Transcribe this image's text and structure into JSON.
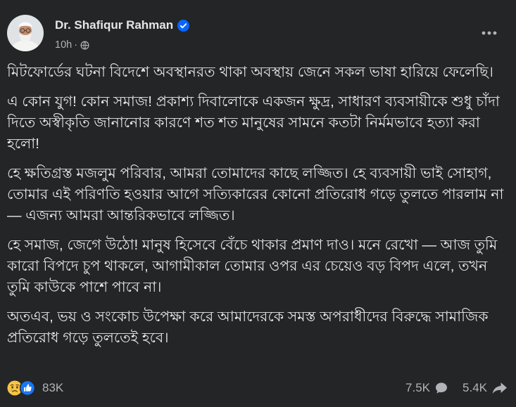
{
  "post": {
    "author": {
      "name": "Dr. Shafiqur Rahman",
      "verified": true,
      "avatar_icon": "profile-photo"
    },
    "timestamp": "10h",
    "separator": "·",
    "privacy_icon": "globe-icon",
    "more_icon": "more-options-icon",
    "paragraphs": [
      "মিটফোর্ডের ঘটনা বিদেশে অবস্থানরত থাকা অবস্থায় জেনে সকল ভাষা হারিয়ে ফেলেছি।",
      "এ কোন যুগ! কোন সমাজ! প্রকাশ্য দিবালোকে একজন ক্ষুদ্র, সাধারণ ব্যবসায়ীকে শুধু চাঁদা দিতে অস্বীকৃতি জানানোর কারণে শত শত মানুষের সামনে কতটা নির্মমভাবে হত্যা করা হলো!",
      "হে ক্ষতিগ্রস্ত মজলুম পরিবার, আমরা তোমাদের কাছে লজ্জিত। হে ব্যবসায়ী ভাই সোহাগ, তোমার এই পরিণতি হওয়ার আগে সত্যিকারের কোনো প্রতিরোধ গড়ে তুলতে পারলাম না — এজন্য আমরা আন্তরিকভাবে লজ্জিত।",
      "হে সমাজ, জেগে উঠো! মানুষ হিসেবে বেঁচে থাকার প্রমাণ দাও। মনে রেখো — আজ তুমি কারো বিপদে চুপ থাকলে, আগামীকাল তোমার ওপর এর চেয়েও বড় বিপদ এলে, তখন তুমি কাউকে পাশে পাবে না।",
      "অতএব, ভয় ও সংকোচ উপেক্ষা করে আমাদেরকে সমস্ত অপরাধীদের বিরুদ্ধে সামাজিক প্রতিরোধ গড়ে তুলতেই হবে।"
    ]
  },
  "footer": {
    "reaction_icons": [
      "sad-reaction-icon",
      "like-reaction-icon"
    ],
    "reaction_count": "83K",
    "comment_count": "7.5K",
    "comment_icon": "comment-icon",
    "share_count": "5.4K",
    "share_icon": "share-icon"
  },
  "colors": {
    "background": "#242526",
    "text_primary": "#e4e6eb",
    "text_secondary": "#b0b3b8",
    "verified_blue": "#0866ff",
    "like_blue": "#1877f2",
    "sad_yellow": "#f7c544"
  }
}
